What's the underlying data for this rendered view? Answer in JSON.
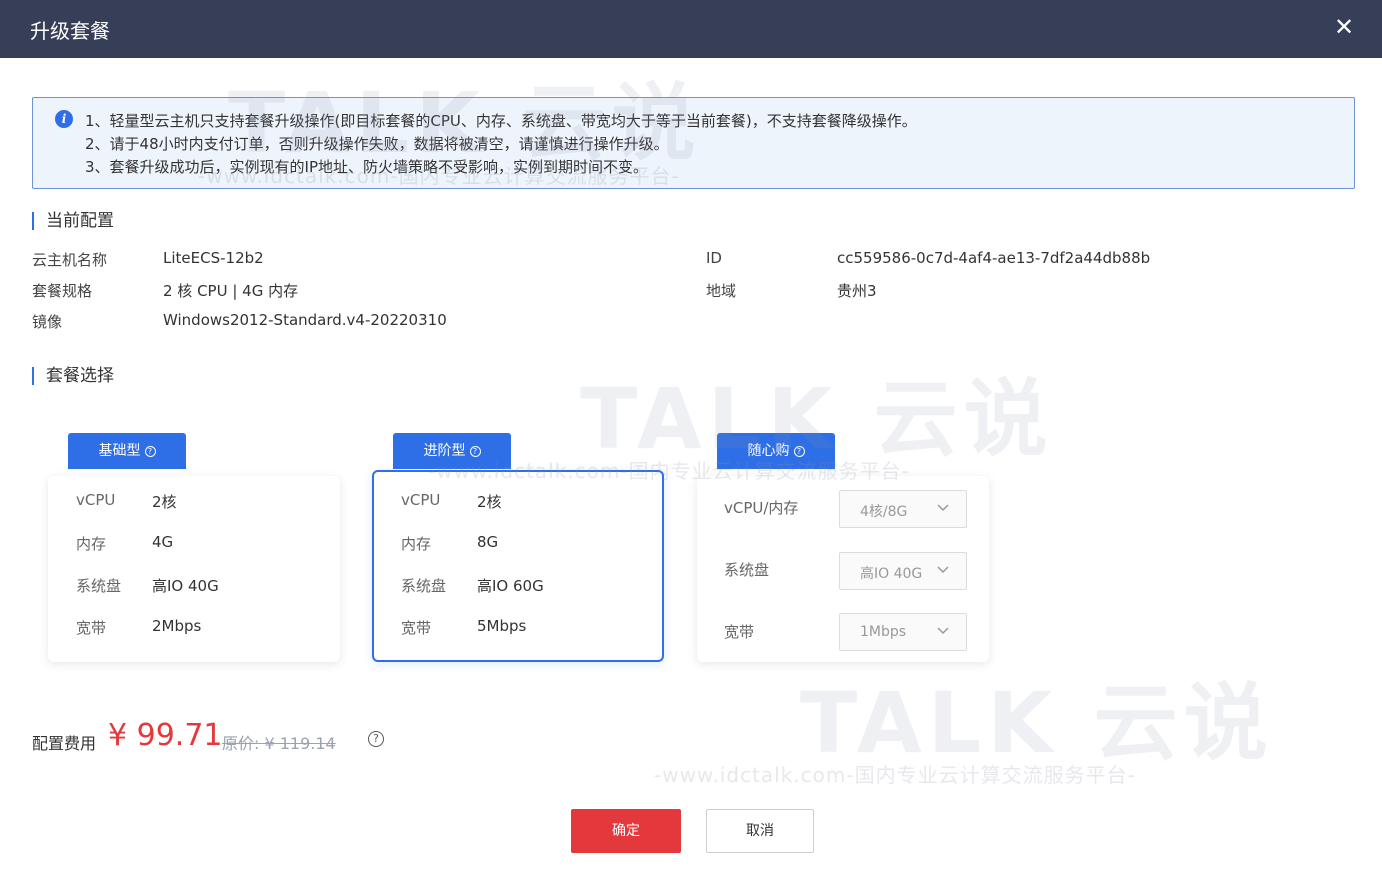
{
  "dialog": {
    "title": "升级套餐",
    "close_icon": "close-icon"
  },
  "notice": {
    "icon": "info-icon",
    "lines": [
      "1、轻量型云主机只支持套餐升级操作(即目标套餐的CPU、内存、系统盘、带宽均大于等于当前套餐)，不支持套餐降级操作。",
      "2、请于48小时内支付订单，否则升级操作失败，数据将被清空，请谨慎进行操作升级。",
      "3、套餐升级成功后，实例现有的IP地址、防火墙策略不受影响，实例到期时间不变。"
    ]
  },
  "current": {
    "section_title": "当前配置",
    "name_label": "云主机名称",
    "name_value": "LiteECS-12b2",
    "id_label": "ID",
    "id_value": "cc559586-0c7d-4af4-ae13-7df2a44db88b",
    "spec_label": "套餐规格",
    "spec_value": "2 核 CPU | 4G 内存",
    "region_label": "地域",
    "region_value": "贵州3",
    "image_label": "镜像",
    "image_value": "Windows2012-Standard.v4-20220310"
  },
  "package": {
    "section_title": "套餐选择",
    "help_glyph": "?",
    "basic": {
      "tab": "基础型",
      "rows": [
        {
          "label": "vCPU",
          "value": "2核"
        },
        {
          "label": "内存",
          "value": "4G"
        },
        {
          "label": "系统盘",
          "value": "高IO 40G"
        },
        {
          "label": "宽带",
          "value": "2Mbps"
        }
      ]
    },
    "advanced": {
      "tab": "进阶型",
      "rows": [
        {
          "label": "vCPU",
          "value": "2核"
        },
        {
          "label": "内存",
          "value": "8G"
        },
        {
          "label": "系统盘",
          "value": "高IO 60G"
        },
        {
          "label": "宽带",
          "value": "5Mbps"
        }
      ]
    },
    "custom": {
      "tab": "随心购",
      "cpu_label": "vCPU/内存",
      "cpu_value": "4核/8G",
      "disk_label": "系统盘",
      "disk_value": "高IO 40G",
      "bw_label": "宽带",
      "bw_value": "1Mbps"
    }
  },
  "fee": {
    "label": "配置费用",
    "price": "¥ 99.71",
    "original": "原价: ¥ 119.14",
    "help_glyph": "?"
  },
  "actions": {
    "confirm": "确定",
    "cancel": "取消"
  },
  "watermark": {
    "brand": "TALK 云说",
    "sub": "-www.idctalk.com-国内专业云计算交流服务平台-"
  },
  "colors": {
    "titlebar": "#373e57",
    "accent": "#2e6ee6",
    "price": "#e4393c"
  }
}
